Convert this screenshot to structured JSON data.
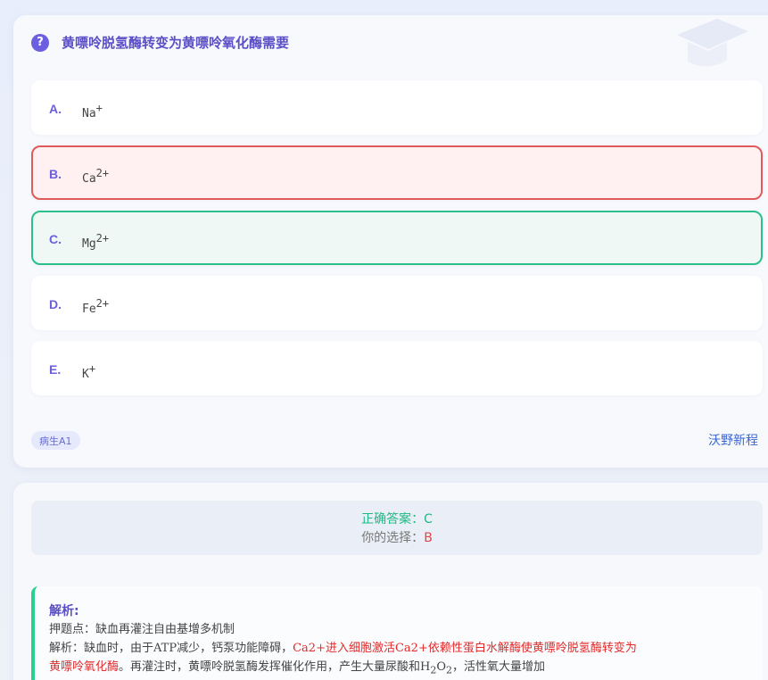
{
  "question": {
    "text": "黄嘌呤脱氢酶转变为黄嘌呤氧化酶需要"
  },
  "options": [
    {
      "letter": "A.",
      "base": "Na",
      "sup": "+"
    },
    {
      "letter": "B.",
      "base": "Ca",
      "sup": "2+"
    },
    {
      "letter": "C.",
      "base": "Mg",
      "sup": "2+"
    },
    {
      "letter": "D.",
      "base": "Fe",
      "sup": "2+"
    },
    {
      "letter": "E.",
      "base": "K",
      "sup": "+"
    }
  ],
  "tag": "病生A1",
  "brand": "沃野新程",
  "answer": {
    "correct_label": "正确答案：",
    "correct_value": "C",
    "mine_label": "你的选择：",
    "mine_value": "B"
  },
  "analysis": {
    "title": "解析:",
    "line1": "押题点：缺血再灌注自由基增多机制",
    "line2_prefix": "解析：缺血时，由于ATP减少，钙泵功能障碍，",
    "line2_red": "Ca2+进入细胞激活Ca2+依赖性蛋白水解酶使黄嘌呤脱氢酶转变为",
    "line3_red": "黄嘌呤氧化酶",
    "line3_rest": "。再灌注时，黄嘌呤脱氢酶发挥催化作用，产生大量尿酸和H",
    "line3_sub1": "2",
    "line3_o": "O",
    "line3_sub2": "2",
    "line3_end": "，活性氧大量增加"
  },
  "colors": {
    "accent": "#6b5fe0",
    "wrong": "#e05a5a",
    "right": "#2bbf8a",
    "brand": "#3a66d8"
  }
}
